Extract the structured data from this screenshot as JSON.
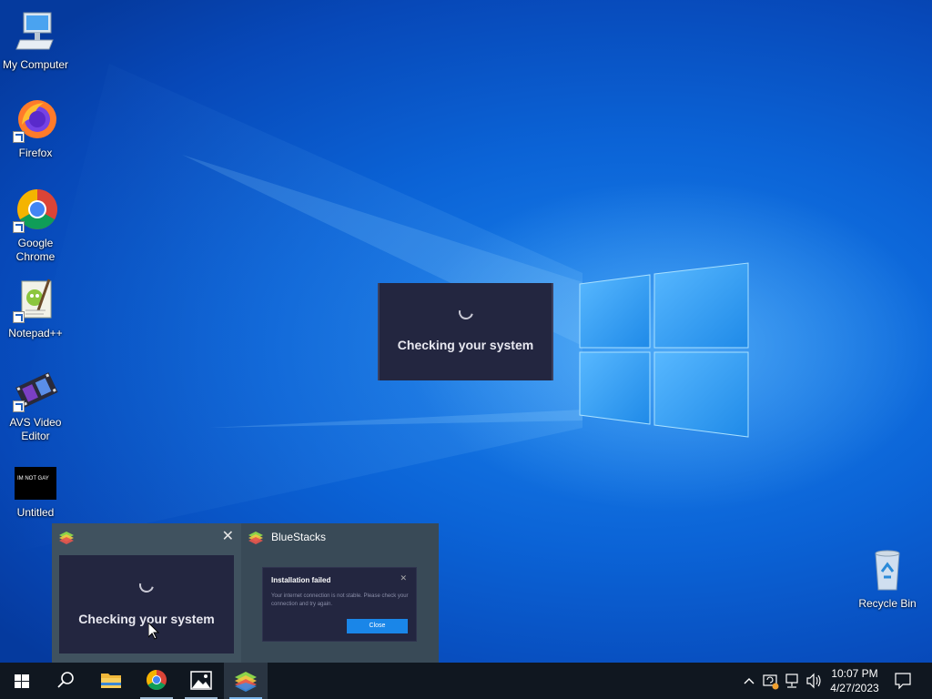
{
  "desktop": {
    "icons": [
      {
        "label": "My Computer"
      },
      {
        "label": "Firefox"
      },
      {
        "label": "Google Chrome"
      },
      {
        "label": "Notepad++"
      },
      {
        "label": "AVS Video Editor"
      },
      {
        "label": "Untitled",
        "thumbnail_text": "IM NOT GAY"
      },
      {
        "label": "Recycle Bin"
      }
    ]
  },
  "splash": {
    "title": "Checking your system"
  },
  "taskbar_preview": {
    "card1": {
      "app": "",
      "thumb_title": "Checking your system"
    },
    "card2": {
      "app": "BlueStacks",
      "dialog_title": "Installation failed",
      "dialog_message": "Your internet connection is not stable. Please check your connection and try again.",
      "dialog_button": "Close"
    }
  },
  "taskbar": {
    "items": [
      {
        "name": "start",
        "icon": "windows-logo-icon"
      },
      {
        "name": "search",
        "icon": "search-icon"
      },
      {
        "name": "file-explorer",
        "icon": "folder-icon"
      },
      {
        "name": "chrome",
        "icon": "chrome-icon"
      },
      {
        "name": "photos",
        "icon": "photos-icon"
      },
      {
        "name": "bluestacks",
        "icon": "bluestacks-icon"
      }
    ],
    "clock": {
      "time": "10:07 PM",
      "date": "4/27/2023"
    }
  },
  "colors": {
    "accent": "#1a86e8",
    "taskbar": "#101720",
    "splash_bg": "#232640"
  }
}
